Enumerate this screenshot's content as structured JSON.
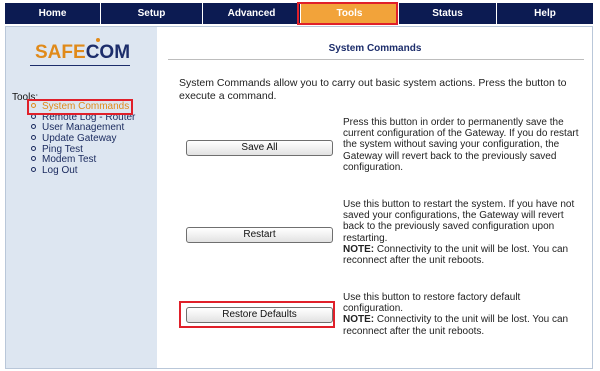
{
  "nav": {
    "tabs": [
      {
        "label": "Home",
        "active": false
      },
      {
        "label": "Setup",
        "active": false
      },
      {
        "label": "Advanced",
        "active": false
      },
      {
        "label": "Tools",
        "active": true
      },
      {
        "label": "Status",
        "active": false
      },
      {
        "label": "Help",
        "active": false
      }
    ]
  },
  "logo": {
    "part1": "SAFE",
    "part2": "COM"
  },
  "sidebar": {
    "heading": "Tools:",
    "items": [
      {
        "label": "System Commands",
        "active": true
      },
      {
        "label": "Remote Log - Router",
        "active": false
      },
      {
        "label": "User Management",
        "active": false
      },
      {
        "label": "Update Gateway",
        "active": false
      },
      {
        "label": "Ping Test",
        "active": false
      },
      {
        "label": "Modem Test",
        "active": false
      },
      {
        "label": "Log Out",
        "active": false
      }
    ]
  },
  "main": {
    "title": "System Commands",
    "intro": "System Commands allow you to carry out basic system actions. Press the button to execute a command.",
    "commands": [
      {
        "button": "Save All",
        "description": "Press this button in order to permanently save the current configuration of the Gateway. If you do restart the system without saving your configuration, the Gateway will revert back to the previously saved configuration.",
        "note_label": "",
        "note": ""
      },
      {
        "button": "Restart",
        "description": "Use this button to restart the system. If you have not saved your configurations, the Gateway will revert back to the previously saved configuration upon restarting.",
        "note_label": "NOTE:",
        "note": " Connectivity to the unit will be lost. You can reconnect after the unit reboots."
      },
      {
        "button": "Restore Defaults",
        "description": "Use this button to restore factory default configuration.",
        "note_label": "NOTE:",
        "note": " Connectivity to the unit will be lost. You can reconnect after the unit reboots."
      }
    ]
  },
  "colors": {
    "nav_bg": "#0c1b52",
    "active_tab": "#f2a33a",
    "sidebar_bg": "#dde6f1",
    "highlight": "#e0202a",
    "logo_orange": "#e08a1a",
    "logo_navy": "#1c2d6b"
  }
}
